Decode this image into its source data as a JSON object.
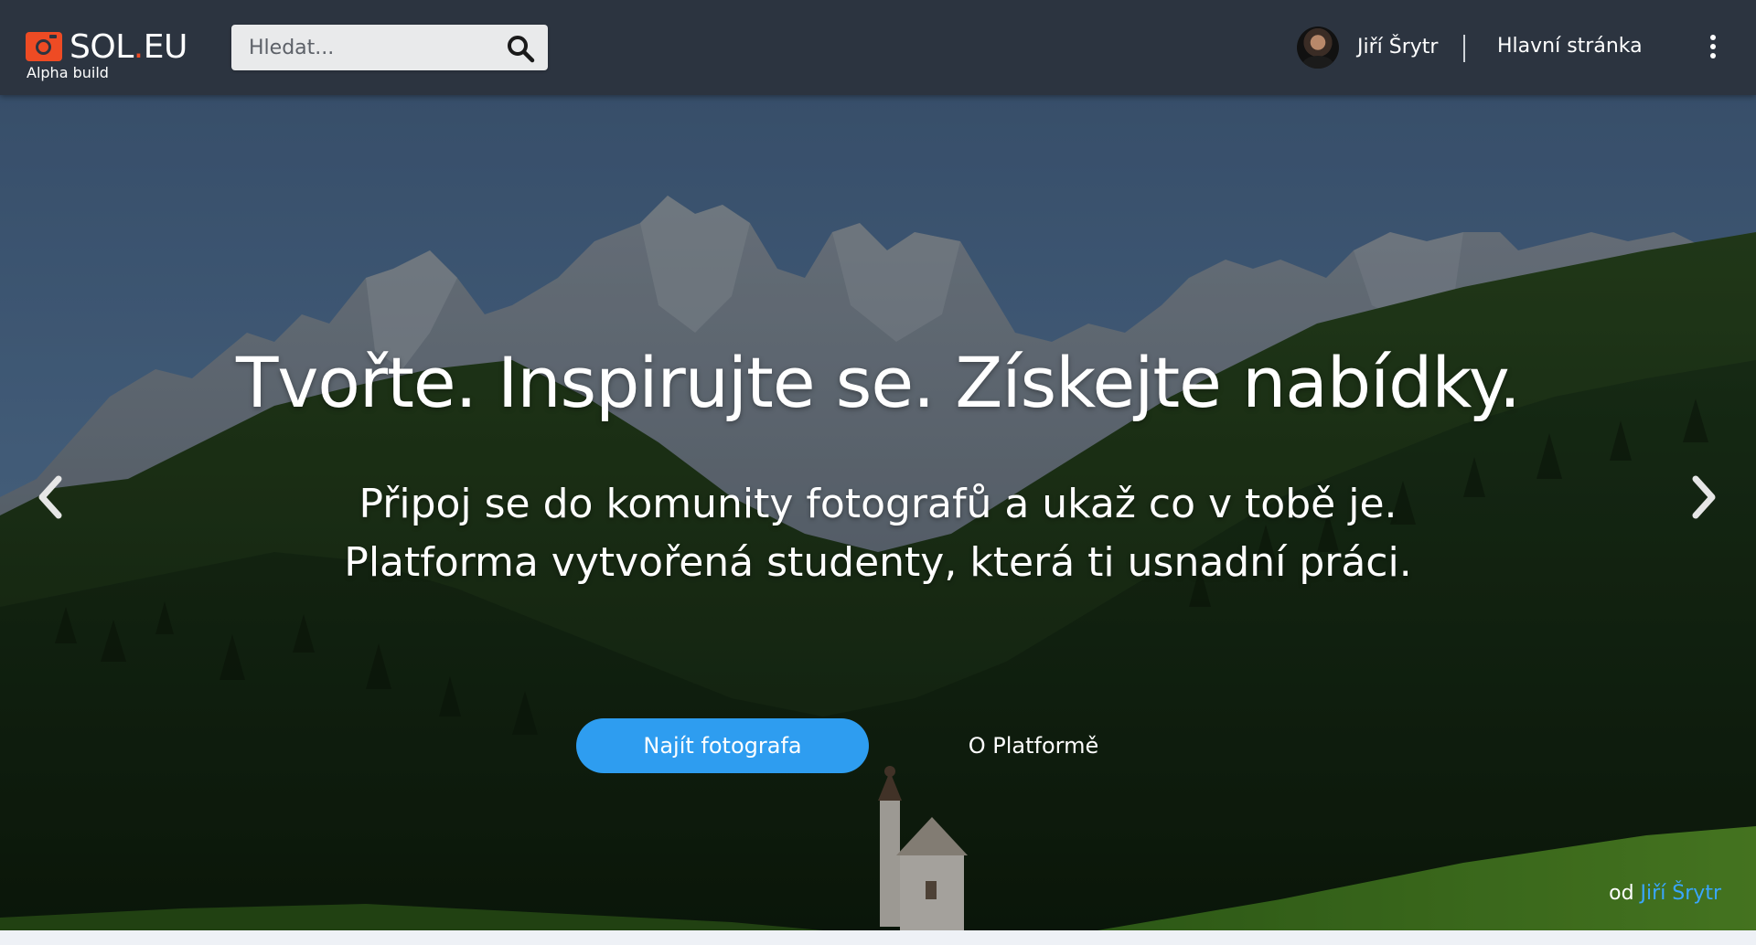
{
  "header": {
    "logo_text_left": "SOL",
    "logo_text_dot": ".",
    "logo_text_right": "EU",
    "logo_subtitle": "Alpha build",
    "search_placeholder": "Hledat...",
    "user_name": "Jiří Šrytr",
    "home_link": "Hlavní stránka"
  },
  "hero": {
    "headline": "Tvořte. Inspirujte se. Získejte nabídky.",
    "subline_1": "Připoj se do komunity fotografů a ukaž co v tobě je.",
    "subline_2": "Platforma vytvořená studenty, která ti usnadní práci.",
    "primary_button": "Najít fotografa",
    "secondary_button": "O Platformě",
    "credit_prefix": "od",
    "credit_author": "Jiří Šrytr"
  },
  "colors": {
    "topbar": "#2c3440",
    "brand_accent": "#ee4b24",
    "button_blue": "#2e9df0",
    "link_blue": "#3aa6ff"
  },
  "icons": {
    "logo": "camera-icon",
    "search": "search-icon",
    "more": "more-vertical-icon",
    "prev": "chevron-left-icon",
    "next": "chevron-right-icon"
  }
}
